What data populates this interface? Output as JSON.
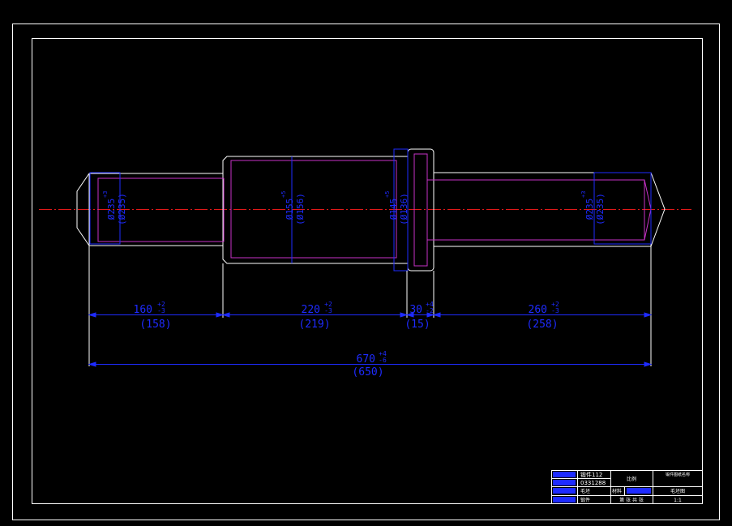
{
  "colors": {
    "background": "#000000",
    "frame": "#ffffff",
    "outline": "#ffffff",
    "stock_outline": "#c832c8",
    "dimension": "#1e2bff",
    "centerline": "#e01818",
    "title_block_field": "#1e2bff"
  },
  "dimensions": {
    "seg1": {
      "nominal": "160",
      "tol_upper": "+2",
      "tol_lower": "-3",
      "actual": "(158)"
    },
    "seg2": {
      "nominal": "220",
      "tol_upper": "+2",
      "tol_lower": "-3",
      "actual": "(219)"
    },
    "seg3": {
      "nominal": "30",
      "tol_upper": "+4",
      "tol_lower": "-2",
      "actual": "(15)"
    },
    "seg4": {
      "nominal": "260",
      "tol_upper": "+2",
      "tol_lower": "-3",
      "actual": "(258)"
    },
    "total": {
      "nominal": "670",
      "tol_upper": "+4",
      "tol_lower": "-6",
      "actual": "(650)"
    }
  },
  "diameters": {
    "d1": {
      "nominal": "Ø235",
      "tol": "+3",
      "actual": "(Ø235)"
    },
    "d2": {
      "nominal": "Ø155",
      "tol": "+5",
      "actual": "(Ø156)"
    },
    "d3": {
      "nominal": "Ø145",
      "tol": "+5",
      "actual": "(Ø136)"
    },
    "d4": {
      "nominal": "Ø235",
      "tol": "+3",
      "actual": "(Ø235)"
    }
  },
  "title_block": {
    "r1_value": "锻件112",
    "r2_value": "0331288",
    "r3_value": "毛坯",
    "r4_value": "锻件",
    "mid_top": "比例",
    "r3_mid": "材料",
    "r4_mid": "第 张 共 张",
    "right_top": "锻件图纸名称",
    "right_r3": "毛坯图",
    "right_r4": "1:1"
  }
}
